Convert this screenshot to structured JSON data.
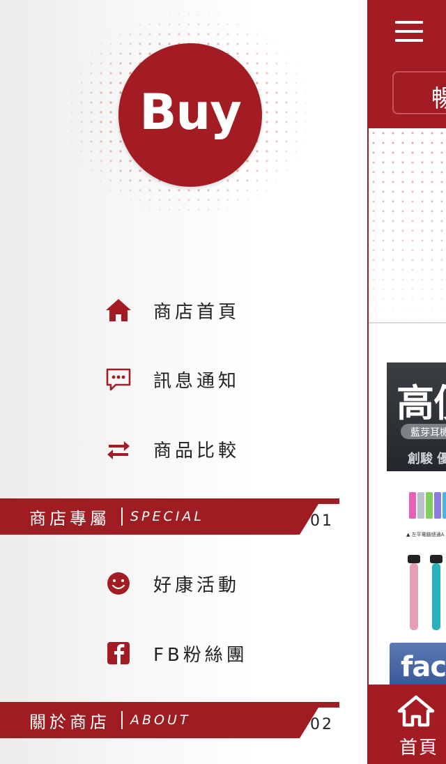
{
  "drawer": {
    "logo_text": "Buy",
    "menu_top": [
      {
        "label": "商店首頁",
        "icon": "home-icon"
      },
      {
        "label": "訊息通知",
        "icon": "message-icon"
      },
      {
        "label": "商品比較",
        "icon": "compare-icon"
      }
    ],
    "section_special": {
      "title": "商店專屬",
      "subtitle": "SPECIAL",
      "number": "01"
    },
    "menu_special": [
      {
        "label": "好康活動",
        "icon": "smile-icon"
      },
      {
        "label": "FB粉絲團",
        "icon": "facebook-icon"
      }
    ],
    "section_about": {
      "title": "關於商店",
      "subtitle": "ABOUT",
      "number": "02"
    }
  },
  "main": {
    "top_tab_partial": "暢",
    "product1": {
      "headline": "高價",
      "pill": "藍芽耳機",
      "sub": "創駿 優"
    },
    "product2_caption": "▲ 左平電腦總通A",
    "fb_banner_text": "face",
    "tabbar": {
      "home_label": "首頁",
      "icon": "home-icon"
    }
  },
  "colors": {
    "brand_red": "#a31b23",
    "band_red": "#9f1c23",
    "text_dark": "#222222"
  }
}
